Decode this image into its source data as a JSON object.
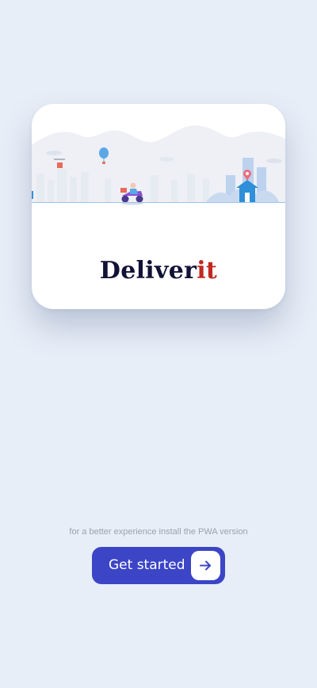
{
  "splash": {
    "illustration": "delivery-scooter-city-illustration",
    "brand": {
      "part1": "Deliver",
      "part2": "it",
      "colors": {
        "part1": "#121237",
        "part2": "#c0281f"
      }
    }
  },
  "footer": {
    "hint": "for a better experience install the PWA version",
    "button": {
      "label": "Get started",
      "icon": "arrow-right-icon",
      "color": "#3c45c6"
    }
  }
}
